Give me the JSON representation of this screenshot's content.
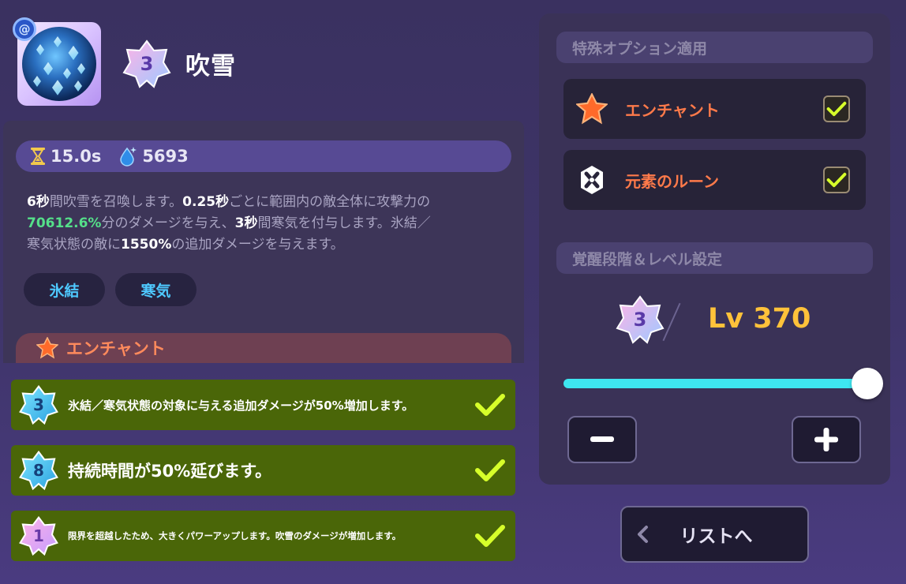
{
  "skill": {
    "name": "吹雪",
    "grade": "3",
    "icon": "blizzard-skill-icon",
    "type_icon": "water-element-icon"
  },
  "stats": {
    "cooldown": "15.0s",
    "cooldown_icon": "hourglass-icon",
    "cost": "5693",
    "cost_icon": "mana-drop-icon"
  },
  "description": {
    "line1": [
      "6秒",
      "間吹雪を召喚します。",
      "0.25秒",
      "ごとに範囲内の敵全体に攻撃力の"
    ],
    "line2": [
      "70612.6%",
      "分のダメージを与え、",
      "3秒",
      "間寒気を付与します。氷結／"
    ],
    "line3": [
      "寒気状態の敵に",
      "1550%",
      "の追加ダメージを与えます。"
    ]
  },
  "tags": [
    "氷結",
    "寒気"
  ],
  "enchant_section": {
    "title": "エンチャント",
    "icon": "enchant-star-icon"
  },
  "enchant_effects": [
    {
      "grade": "3",
      "text": "氷結／寒気状態の対象に与える追加ダメージが50%増加します。",
      "checked": true
    },
    {
      "grade": "8",
      "text": "持続時間が50%延びます。",
      "checked": true
    },
    {
      "grade": "1",
      "text": "限界を超越したため、大きくパワーアップします。吹雪のダメージが増加します。",
      "checked": true
    }
  ],
  "special_options": {
    "title": "特殊オプション適用",
    "items": [
      {
        "label": "エンチャント",
        "icon": "enchant-star-icon",
        "checked": true
      },
      {
        "label": "元素のルーン",
        "icon": "element-rune-icon",
        "checked": true
      }
    ]
  },
  "awakening": {
    "title": "覚醒段階＆レベル設定",
    "grade": "3",
    "level_text": "Lv 370",
    "level_slider_fraction": 1.0
  },
  "buttons": {
    "minus": "−",
    "plus": "+",
    "back_to_list": "リストへ"
  },
  "colors": {
    "enchant_orange": "#ff7a4a",
    "level_gold": "#ffc23a",
    "highlight_green": "#55e08a",
    "tag_blue": "#4ec9ff",
    "effect_row_green": "#4a6608",
    "check_lime": "#d7ff2a",
    "slider_cyan": "#3ee6f0"
  }
}
